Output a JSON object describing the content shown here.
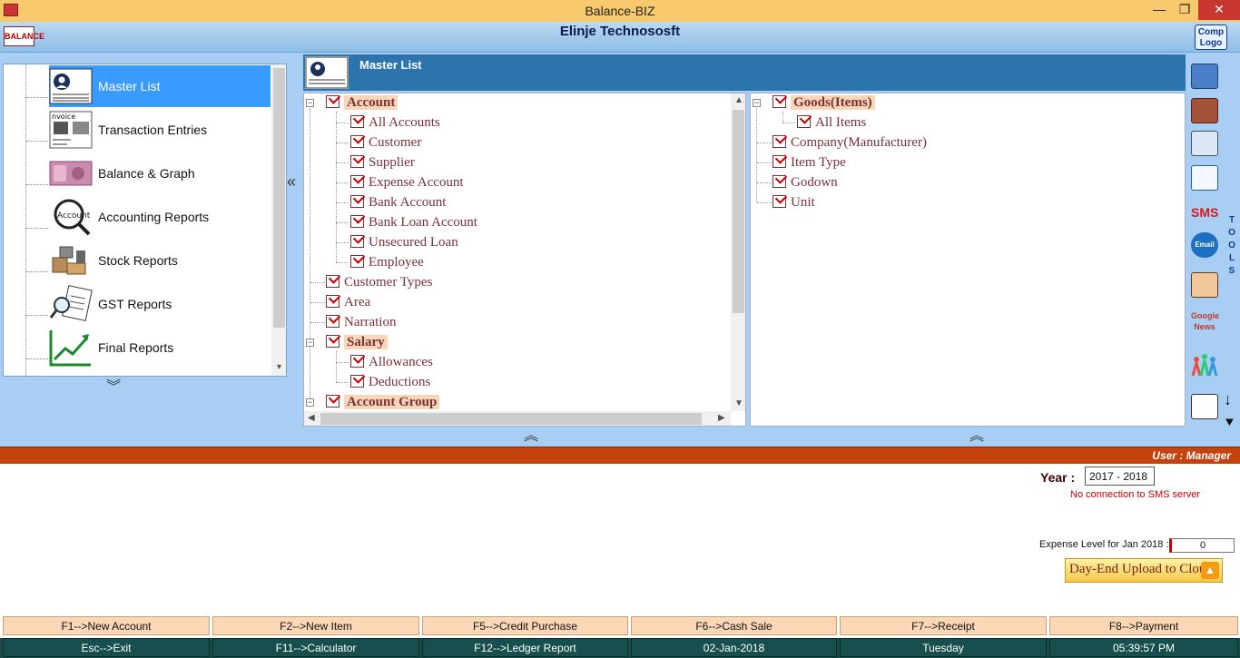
{
  "window": {
    "title": "Balance-BIZ",
    "min": "—",
    "max": "❐",
    "close": "✕"
  },
  "header": {
    "logo": "BALANCE",
    "company": "Elinje Technososft",
    "comp_logo_line1": "Comp",
    "comp_logo_line2": "Logo"
  },
  "left_menu": [
    {
      "label": "Master List",
      "icon": "contact-card-icon",
      "selected": true
    },
    {
      "label": "Transaction Entries",
      "icon": "invoice-icon",
      "selected": false
    },
    {
      "label": "Balance & Graph",
      "icon": "banknote-icon",
      "selected": false
    },
    {
      "label": "Accounting Reports",
      "icon": "account-magnifier-icon",
      "selected": false
    },
    {
      "label": "Stock Reports",
      "icon": "boxes-icon",
      "selected": false
    },
    {
      "label": "GST Reports",
      "icon": "report-magnifier-icon",
      "selected": false
    },
    {
      "label": "Final Reports",
      "icon": "growth-chart-icon",
      "selected": false
    }
  ],
  "center": {
    "title": "Master List"
  },
  "tree_left": {
    "account": {
      "label": "Account",
      "children": [
        "All Accounts",
        "Customer",
        "Supplier",
        "Expense Account",
        "Bank Account",
        "Bank Loan Account",
        "Unsecured Loan",
        "Employee"
      ]
    },
    "customer_types": "Customer Types",
    "area": "Area",
    "narration": "Narration",
    "salary": {
      "label": "Salary",
      "children": [
        "Allowances",
        "Deductions"
      ]
    },
    "account_group": "Account Group"
  },
  "tree_right": {
    "goods": {
      "label": "Goods(Items)",
      "children": [
        "All Items"
      ]
    },
    "company": "Company(Manufacturer)",
    "item_type": "Item Type",
    "godown": "Godown",
    "unit": "Unit"
  },
  "tools": {
    "vertical_label": [
      "T",
      "O",
      "O",
      "L",
      "S"
    ],
    "sms": "SMS",
    "email": "Email",
    "google_news": "Google News"
  },
  "status": {
    "user": "User : Manager",
    "year_label": "Year :",
    "year_value": "2017 - 2018",
    "sms_message": "No connection to SMS server",
    "expense_label": "Expense Level for Jan 2018 :",
    "expense_value": "0",
    "upload_button": "Day-End Upload to Cloud"
  },
  "fkeys_row1": [
    "F1-->New Account",
    "F2-->New Item",
    "F5-->Credit Purchase",
    "F6-->Cash Sale",
    "F7-->Receipt",
    "F8-->Payment"
  ],
  "fkeys_row2": [
    "Esc-->Exit",
    "F11-->Calculator",
    "F12-->Ledger Report",
    "02-Jan-2018",
    "Tuesday",
    "05:39:57 PM"
  ],
  "colors": {
    "title_bar": "#f7c96c",
    "header": "#8dbde6",
    "selected": "#3a9bff",
    "tree_text": "#7a3036",
    "user_bar": "#c3420e",
    "fkey_row1": "#fcd7b6",
    "fkey_row2": "#174f4f"
  }
}
